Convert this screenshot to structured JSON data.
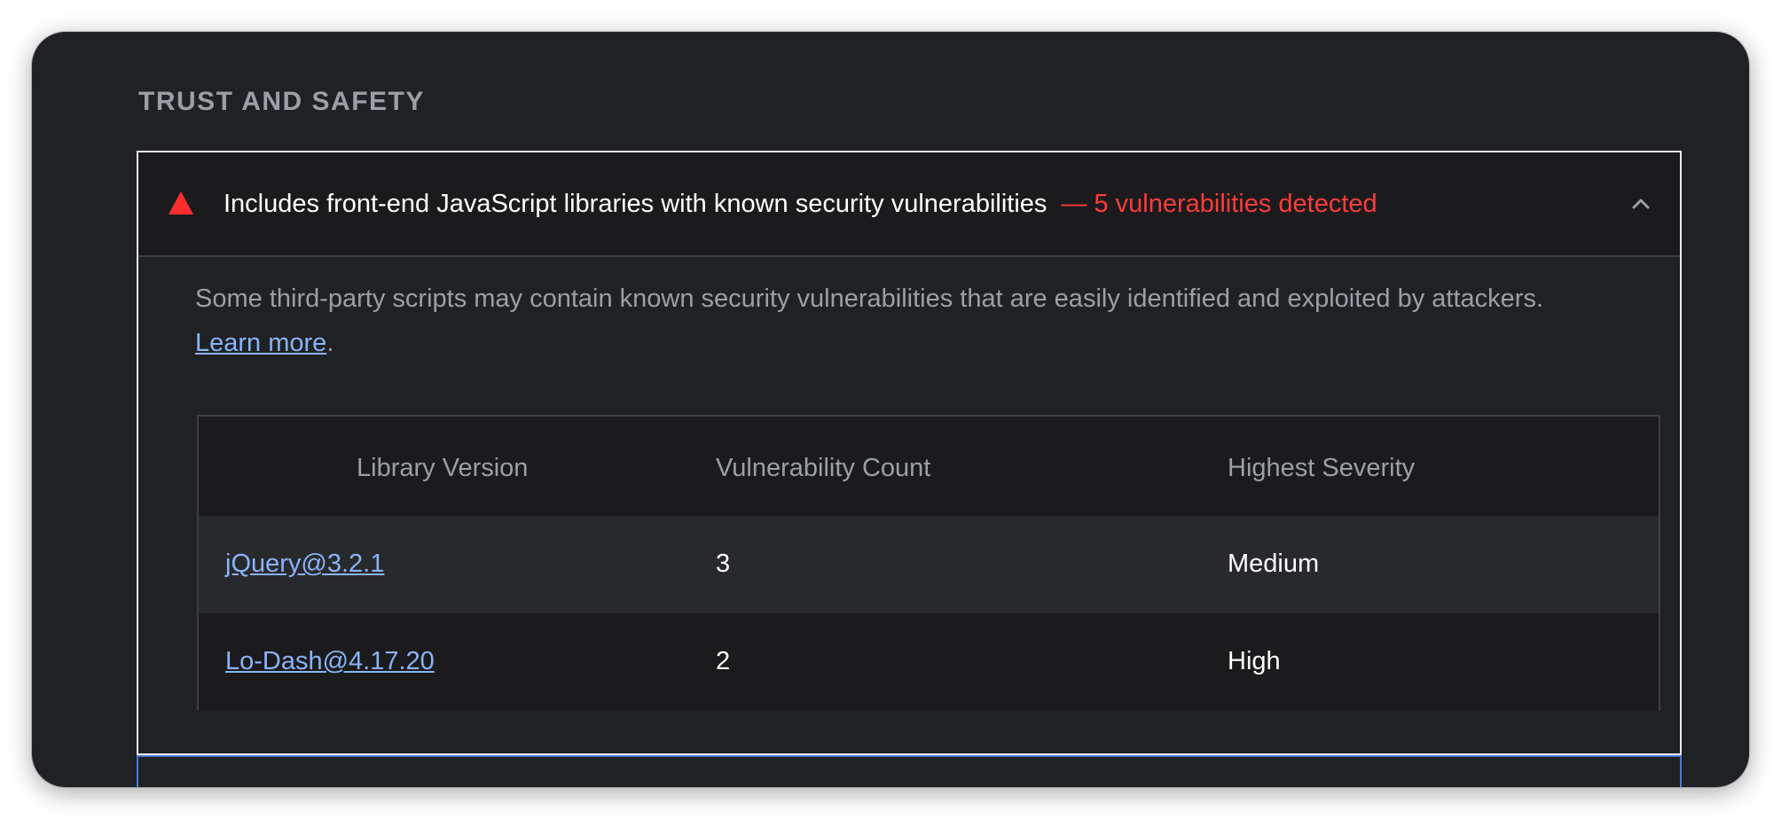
{
  "section": {
    "title": "TRUST AND SAFETY"
  },
  "audit": {
    "title": "Includes front-end JavaScript libraries with known security vulnerabilities",
    "display_value": "— 5 vulnerabilities detected",
    "status_icon": "warning-triangle-icon",
    "status_color": "#ff2e2e",
    "expand_icon": "chevron-up-icon",
    "description": "Some third-party scripts may contain known security vulnerabilities that are easily identified and exploited by attackers.",
    "learn_more_label": "Learn more",
    "description_end": ".",
    "table": {
      "headers": [
        "Library Version",
        "Vulnerability Count",
        "Highest Severity"
      ],
      "rows": [
        {
          "library": "jQuery@3.2.1",
          "count": "3",
          "severity": "Medium"
        },
        {
          "library": "Lo-Dash@4.17.20",
          "count": "2",
          "severity": "High"
        }
      ]
    }
  },
  "colors": {
    "background": "#202124",
    "link": "#8ab4f8",
    "fail": "#ff3b3b",
    "muted_text": "#9aa0a6"
  }
}
